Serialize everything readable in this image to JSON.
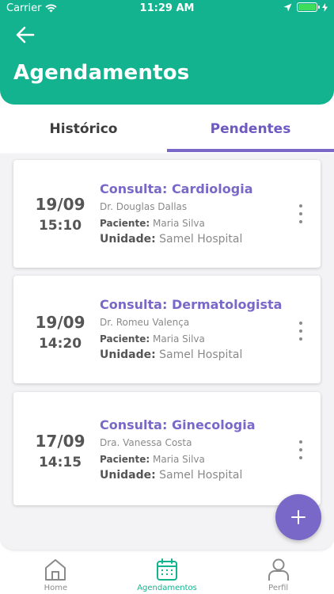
{
  "status_bar": {
    "carrier": "Carrier",
    "time": "11:29 AM"
  },
  "header": {
    "title": "Agendamentos",
    "background": "#13b38f"
  },
  "tabs": [
    {
      "label": "Histórico",
      "active": false
    },
    {
      "label": "Pendentes",
      "active": true
    }
  ],
  "appointments": [
    {
      "date": "19/09",
      "time": "15:10",
      "title": "Consulta: Cardiologia",
      "doctor": "Dr. Douglas Dallas",
      "patient_label": "Paciente:",
      "patient": "Maria Silva",
      "unit_label": "Unidade:",
      "unit": "Samel Hospital"
    },
    {
      "date": "19/09",
      "time": "14:20",
      "title": "Consulta: Dermatologista",
      "doctor": "Dr. Romeu Valença",
      "patient_label": "Paciente:",
      "patient": "Maria Silva",
      "unit_label": "Unidade:",
      "unit": "Samel Hospital"
    },
    {
      "date": "17/09",
      "time": "14:15",
      "title": "Consulta: Ginecologia",
      "doctor": "Dra. Vanessa Costa",
      "patient_label": "Paciente:",
      "patient": "Maria Silva",
      "unit_label": "Unidade:",
      "unit": "Samel Hospital"
    }
  ],
  "fab": {
    "icon": "plus-icon",
    "color": "#7a68c8"
  },
  "bottom_nav": [
    {
      "label": "Home",
      "icon": "home-icon",
      "active": false
    },
    {
      "label": "Agendamentos",
      "icon": "calendar-icon",
      "active": true
    },
    {
      "label": "Perfil",
      "icon": "user-icon",
      "active": false
    }
  ],
  "colors": {
    "primary": "#13b38f",
    "accent": "#7a68c8"
  }
}
